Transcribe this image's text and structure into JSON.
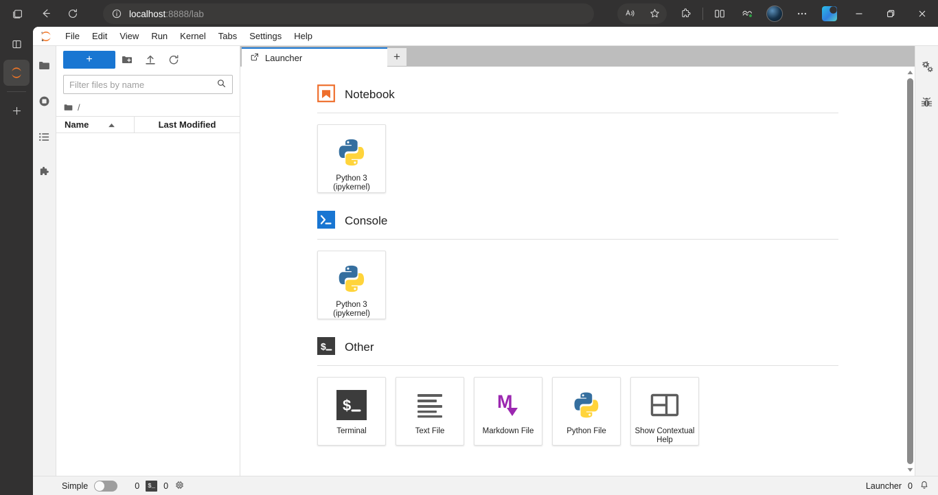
{
  "browser": {
    "url_host": "localhost",
    "url_rest": ":8888/lab",
    "nav": {
      "back": "Back",
      "refresh": "Refresh",
      "collections": "Collections"
    },
    "toolbar": {
      "read_aloud": "Read aloud",
      "favorite": "Add this page to favorites",
      "extensions": "Extensions",
      "split_screen": "Split screen",
      "browser_essentials": "Browser essentials",
      "profile": "Profile",
      "settings_more": "Settings and more",
      "copilot": "Copilot"
    },
    "window": {
      "minimize": "Minimize",
      "restore": "Restore",
      "close": "Close"
    },
    "tabstrip": {
      "tab_actions": "Tab actions menu",
      "active_tab": "localhost:8888/lab",
      "new_tab": "New tab"
    }
  },
  "jupyter": {
    "menu": [
      "File",
      "Edit",
      "View",
      "Run",
      "Kernel",
      "Tabs",
      "Settings",
      "Help"
    ],
    "sidebar_left": [
      {
        "name": "file-browser",
        "label": "File Browser"
      },
      {
        "name": "running-terminals",
        "label": "Running Terminals and Kernels"
      },
      {
        "name": "command-palette",
        "label": "Commands"
      },
      {
        "name": "extension-manager",
        "label": "Extension Manager"
      }
    ],
    "sidebar_right": [
      {
        "name": "property-inspector",
        "label": "Property Inspector"
      },
      {
        "name": "debugger",
        "label": "Debugger"
      }
    ],
    "filebrowser": {
      "new_launcher_label": "+",
      "new_folder": "New Folder",
      "upload": "Upload Files",
      "refresh": "Refresh the file browser",
      "filter_placeholder": "Filter files by name",
      "filter_value": "",
      "breadcrumb": "/",
      "columns": {
        "name": "Name",
        "modified": "Last Modified"
      },
      "sort_direction": "ascending",
      "rows": []
    },
    "dock": {
      "tabs": [
        {
          "label": "Launcher",
          "icon": "launcher-icon",
          "active": true
        }
      ],
      "new_tab_label": "+"
    },
    "launcher": {
      "sections": [
        {
          "id": "notebook",
          "title": "Notebook",
          "icon": "notebook-icon",
          "cards": [
            {
              "label": "Python 3\n(ipykernel)",
              "label_line1": "Python 3",
              "label_line2": "(ipykernel)",
              "icon": "python-logo"
            }
          ]
        },
        {
          "id": "console",
          "title": "Console",
          "icon": "console-icon",
          "cards": [
            {
              "label": "Python 3\n(ipykernel)",
              "label_line1": "Python 3",
              "label_line2": "(ipykernel)",
              "icon": "python-logo"
            }
          ]
        },
        {
          "id": "other",
          "title": "Other",
          "icon": "terminal-icon",
          "cards": [
            {
              "label": "Terminal",
              "label_line1": "Terminal",
              "label_line2": "",
              "icon": "terminal-icon"
            },
            {
              "label": "Text File",
              "label_line1": "Text File",
              "label_line2": "",
              "icon": "text-file-icon"
            },
            {
              "label": "Markdown File",
              "label_line1": "Markdown File",
              "label_line2": "",
              "icon": "markdown-icon"
            },
            {
              "label": "Python File",
              "label_line1": "Python File",
              "label_line2": "",
              "icon": "python-logo"
            },
            {
              "label": "Show Contextual Help",
              "label_line1": "Show Contextual",
              "label_line2": "Help",
              "icon": "contextual-help-icon"
            }
          ]
        }
      ]
    },
    "statusbar": {
      "mode_label": "Simple",
      "mode_on": false,
      "kernel_count": "0",
      "terminal_count": "0",
      "current_activity": "Launcher",
      "notification_count": "0"
    }
  },
  "colors": {
    "accent_blue": "#1976d2",
    "jupyter_orange": "#f37726",
    "markdown_purple": "#9b27b0",
    "python_blue": "#326a9b",
    "python_yellow": "#ffd43b",
    "chrome_dark": "#323131"
  }
}
